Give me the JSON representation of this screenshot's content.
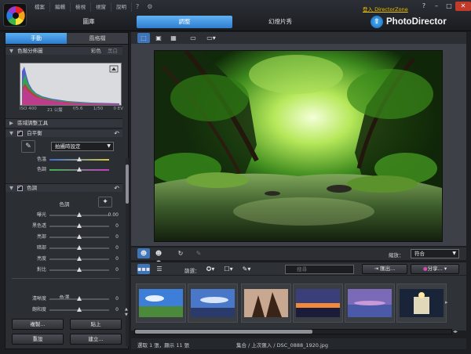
{
  "menu": {
    "items": [
      "檔案",
      "編輯",
      "檢視",
      "視窗",
      "說明"
    ],
    "icons": [
      "question-icon",
      "gear-icon"
    ]
  },
  "modes": [
    "圖庫",
    "調整",
    "幻燈片秀"
  ],
  "active_mode": "調整",
  "account": {
    "link": "登入 DirectorZone"
  },
  "window_controls": [
    "?",
    "–",
    "□",
    "✕"
  ],
  "brand": {
    "name": "PhotoDirector"
  },
  "left_panel": {
    "tabs": [
      "手動",
      "風格檔"
    ],
    "histogram": {
      "title": "色階分佈圖",
      "modes": [
        "彩色",
        "黑白"
      ],
      "exif": [
        "ISO 400",
        "21 公釐",
        "f/5.6",
        "1/50",
        "0 EV"
      ]
    },
    "regional_tools": "區域調整工具",
    "white_balance": {
      "title": "白平衡",
      "preset": "拍攝時設定",
      "sliders": [
        {
          "label": "色溫",
          "value": "",
          "position": 0.5
        },
        {
          "label": "色調",
          "value": "",
          "position": 0.5
        }
      ]
    },
    "tone": {
      "title": "色調",
      "subtitle": "色調",
      "sliders": [
        {
          "label": "曝光",
          "value": "0.00",
          "position": 0.5
        },
        {
          "label": "黑色透",
          "value": "0",
          "position": 0.5
        },
        {
          "label": "亮部",
          "value": "0",
          "position": 0.5
        },
        {
          "label": "暗部",
          "value": "0",
          "position": 0.5
        },
        {
          "label": "亮度",
          "value": "0",
          "position": 0.5
        },
        {
          "label": "對比",
          "value": "0",
          "position": 0.5
        }
      ]
    },
    "color": {
      "subtitle": "色澤",
      "sliders": [
        {
          "label": "清晰度",
          "value": "0",
          "position": 0.5
        },
        {
          "label": "飽和度",
          "value": "0",
          "position": 0.5
        }
      ]
    },
    "buttons": {
      "copy": "複製...",
      "paste": "貼上",
      "reset": "重設",
      "create": "建立..."
    }
  },
  "viewer": {
    "zoom_label": "縮放：",
    "zoom_value": "符合"
  },
  "browser": {
    "sort_label": "篩選：",
    "search_placeholder": "搜尋",
    "export_label": "匯出...",
    "share_label": "分享..."
  },
  "status": {
    "left": "選取 1 張，顯示 11 張",
    "path": "集合 / 上次匯入 / DSC_0888_1920.jpg"
  },
  "colors": {
    "accent": "#3e8ee0",
    "link": "#f0c400",
    "close": "#c23a2a"
  }
}
